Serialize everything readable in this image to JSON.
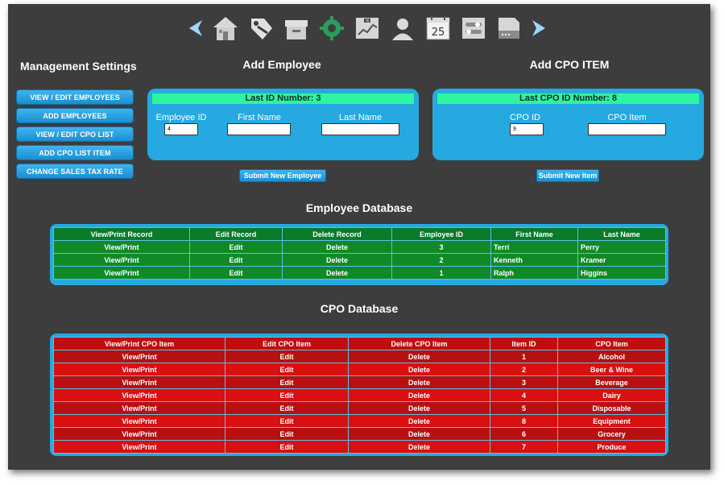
{
  "toolbar": {
    "icons": [
      "back-arrow-icon",
      "home-icon",
      "tag-icon",
      "box-icon",
      "gear-icon",
      "chart-icon",
      "person-icon",
      "calendar-icon",
      "settings-toggle-icon",
      "document-icon",
      "forward-arrow-icon"
    ],
    "calendar_day": "25",
    "chart_mini_label": "76"
  },
  "management": {
    "title": "Management Settings",
    "buttons": [
      "VIEW / EDIT EMPLOYEES",
      "ADD EMPLOYEES",
      "VIEW / EDIT CPO LIST",
      "ADD CPO LIST ITEM",
      "CHANGE SALES TAX RATE"
    ]
  },
  "add_employee": {
    "title": "Add Employee",
    "last_id_label": "Last ID Number:  3",
    "fields": {
      "employee_id_label": "Employee ID",
      "employee_id_value": "4",
      "first_name_label": "First Name",
      "first_name_value": "",
      "last_name_label": "Last Name",
      "last_name_value": ""
    },
    "submit_label": "Submit New Employee"
  },
  "add_cpo": {
    "title": "Add CPO ITEM",
    "last_id_label": "Last CPO ID Number:  8",
    "fields": {
      "cpo_id_label": "CPO ID",
      "cpo_id_value": "9",
      "cpo_item_label": "CPO Item",
      "cpo_item_value": ""
    },
    "submit_label": "Submit New Item"
  },
  "employee_db": {
    "title": "Employee Database",
    "headers": [
      "View/Print Record",
      "Edit Record",
      "Delete Record",
      "Employee ID",
      "First Name",
      "Last Name"
    ],
    "rows": [
      [
        "View/Print",
        "Edit",
        "Delete",
        "3",
        "Terri",
        "Perry"
      ],
      [
        "View/Print",
        "Edit",
        "Delete",
        "2",
        "Kenneth",
        "Kramer"
      ],
      [
        "View/Print",
        "Edit",
        "Delete",
        "1",
        "Ralph",
        "Higgins"
      ]
    ]
  },
  "cpo_db": {
    "title": "CPO Database",
    "headers": [
      "View/Print CPO Item",
      "Edit CPO Item",
      "Delete CPO Item",
      "Item ID",
      "CPO Item"
    ],
    "rows": [
      [
        "View/Print",
        "Edit",
        "Delete",
        "1",
        "Alcohol"
      ],
      [
        "View/Print",
        "Edit",
        "Delete",
        "2",
        "Beer & Wine"
      ],
      [
        "View/Print",
        "Edit",
        "Delete",
        "3",
        "Beverage"
      ],
      [
        "View/Print",
        "Edit",
        "Delete",
        "4",
        "Dairy"
      ],
      [
        "View/Print",
        "Edit",
        "Delete",
        "5",
        "Disposable"
      ],
      [
        "View/Print",
        "Edit",
        "Delete",
        "8",
        "Equipment"
      ],
      [
        "View/Print",
        "Edit",
        "Delete",
        "6",
        "Grocery"
      ],
      [
        "View/Print",
        "Edit",
        "Delete",
        "7",
        "Produce"
      ]
    ]
  },
  "colors": {
    "background": "#3d3d3d",
    "accent_blue": "#25a9e0",
    "header_green": "#2ef5a0",
    "employee_row_green": "#0f8a26",
    "cpo_row_red": "#d81010"
  }
}
